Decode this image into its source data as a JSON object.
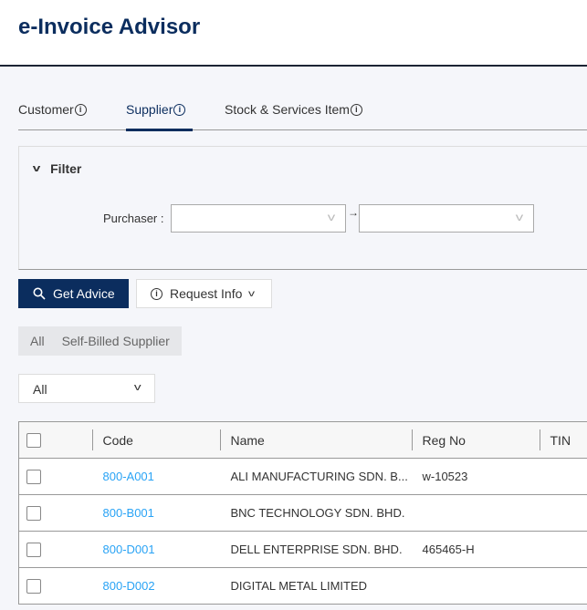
{
  "app": {
    "title": "e-Invoice Advisor"
  },
  "tabs": [
    {
      "label": "Customer"
    },
    {
      "label": "Supplier",
      "active": true
    },
    {
      "label": "Stock & Services Item"
    }
  ],
  "filter": {
    "title": "Filter",
    "purchaser_label": "Purchaser :",
    "from_value": "",
    "to_value": "",
    "range_separator": "→"
  },
  "buttons": {
    "get_advice": "Get Advice",
    "request_info": "Request Info"
  },
  "segment": {
    "options": [
      "All",
      "Self-Billed Supplier"
    ]
  },
  "dropdown": {
    "value": "All"
  },
  "table": {
    "columns": [
      "Code",
      "Name",
      "Reg No",
      "TIN"
    ],
    "rows": [
      {
        "code": "800-A001",
        "name": "ALI MANUFACTURING SDN. B...",
        "reg_no": "w-10523",
        "tin": ""
      },
      {
        "code": "800-B001",
        "name": "BNC TECHNOLOGY SDN. BHD.",
        "reg_no": "",
        "tin": ""
      },
      {
        "code": "800-D001",
        "name": "DELL ENTERPRISE SDN. BHD.",
        "reg_no": "465465-H",
        "tin": ""
      },
      {
        "code": "800-D002",
        "name": "DIGITAL METAL LIMITED",
        "reg_no": "",
        "tin": ""
      }
    ]
  },
  "colors": {
    "primary": "#0b2d5e",
    "link": "#29a3f5"
  }
}
